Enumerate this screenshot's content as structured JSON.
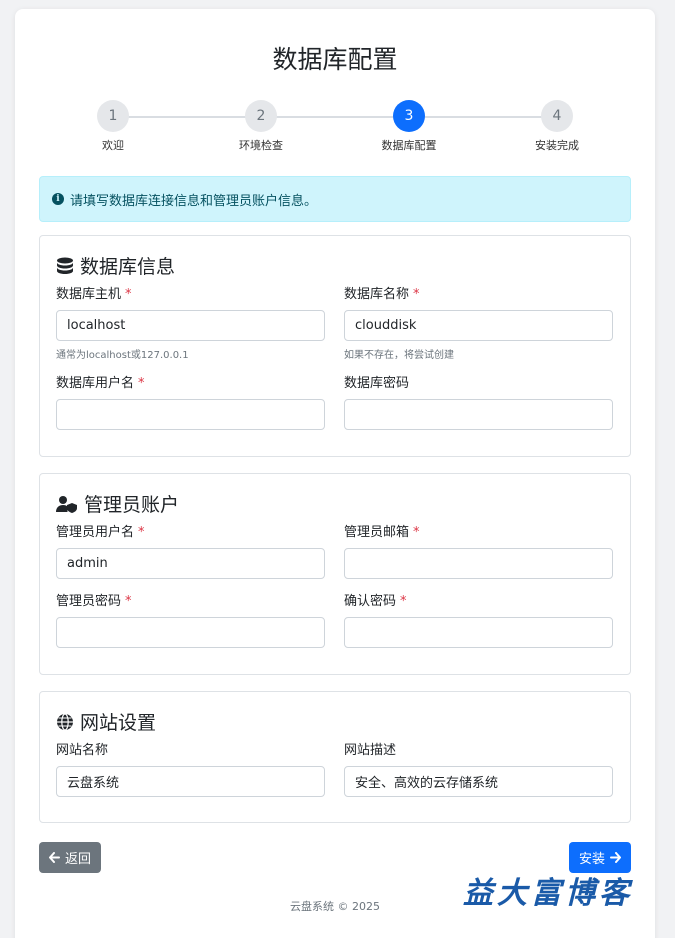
{
  "page": {
    "title": "数据库配置"
  },
  "steps": [
    {
      "num": "1",
      "label": "欢迎"
    },
    {
      "num": "2",
      "label": "环境检查"
    },
    {
      "num": "3",
      "label": "数据库配置"
    },
    {
      "num": "4",
      "label": "安装完成"
    }
  ],
  "alert": {
    "text": "请填写数据库连接信息和管理员账户信息。"
  },
  "db": {
    "title": "数据库信息",
    "host": {
      "label": "数据库主机",
      "value": "localhost",
      "hint": "通常为localhost或127.0.0.1"
    },
    "name": {
      "label": "数据库名称",
      "value": "clouddisk",
      "hint": "如果不存在，将尝试创建"
    },
    "user": {
      "label": "数据库用户名",
      "value": ""
    },
    "password": {
      "label": "数据库密码",
      "value": ""
    }
  },
  "admin": {
    "title": "管理员账户",
    "username": {
      "label": "管理员用户名",
      "value": "admin"
    },
    "email": {
      "label": "管理员邮箱",
      "value": ""
    },
    "password": {
      "label": "管理员密码",
      "value": ""
    },
    "confirm": {
      "label": "确认密码",
      "value": ""
    }
  },
  "site": {
    "title": "网站设置",
    "name": {
      "label": "网站名称",
      "value": "云盘系统"
    },
    "desc": {
      "label": "网站描述",
      "value": "安全、高效的云存储系统"
    }
  },
  "buttons": {
    "back": "返回",
    "install": "安装"
  },
  "footer": {
    "text": "云盘系统 © 2025"
  },
  "watermark": {
    "text": "益大富博客"
  },
  "required_mark": "*",
  "colors": {
    "primary": "#0d6efd",
    "secondary": "#6c757d",
    "info_bg": "#cff4fc",
    "danger": "#dc3545"
  }
}
